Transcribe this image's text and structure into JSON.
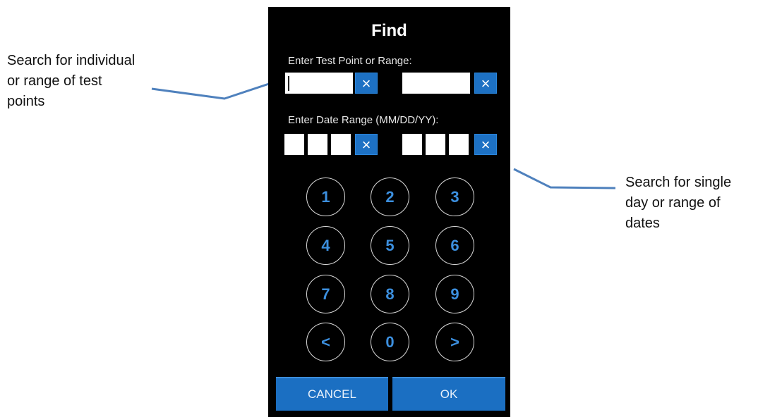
{
  "annotations": {
    "left_lines": [
      "Search for individual",
      "or range of test",
      "points"
    ],
    "right_lines": [
      "Search for single",
      "day or range of",
      "dates"
    ]
  },
  "dialog": {
    "title": "Find",
    "test_point_label": "Enter Test Point or Range:",
    "date_range_label": "Enter Date Range (MM/DD/YY):",
    "clear_icon": "×",
    "keypad": [
      "1",
      "2",
      "3",
      "4",
      "5",
      "6",
      "7",
      "8",
      "9",
      "<",
      "0",
      ">"
    ],
    "cancel_label": "CANCEL",
    "ok_label": "OK"
  },
  "colors": {
    "background": "#000000",
    "accent_blue": "#1d71c4",
    "key_digit": "#3c8fde",
    "leader_line": "#4f81bd"
  }
}
